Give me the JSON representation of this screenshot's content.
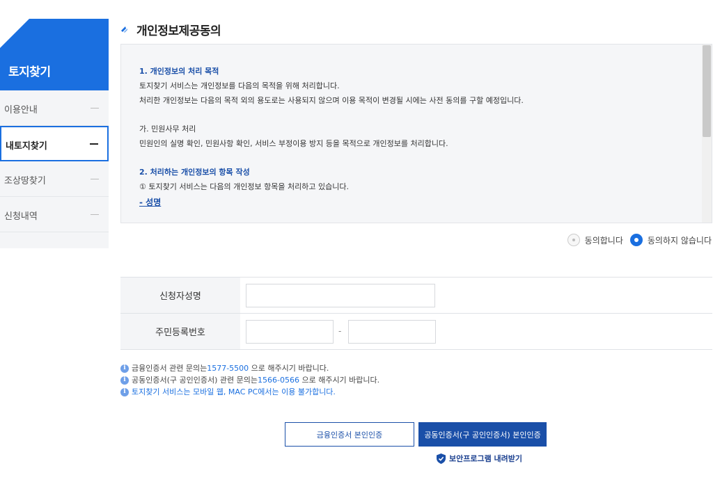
{
  "sidebar": {
    "title": "토지찾기",
    "items": [
      {
        "label": "이용안내",
        "active": false
      },
      {
        "label": "내토지찾기",
        "active": true
      },
      {
        "label": "조상땅찾기",
        "active": false
      },
      {
        "label": "신청내역",
        "active": false
      }
    ]
  },
  "section": {
    "title": "개인정보제공동의"
  },
  "terms": {
    "s1_title": "1. 개인정보의 처리 목적",
    "s1_line1": "토지찾기 서비스는 개인정보를 다음의 목적을 위해 처리합니다.",
    "s1_line2": "처리한 개인정보는 다음의 목적 외의 용도로는 사용되지 않으며 이용 목적이 변경될 시에는 사전 동의를 구할 예정입니다.",
    "ga_title": "가. 민원사무 처리",
    "ga_line1": "민원인의 실명 확인, 민원사항 확인, 서비스 부정이용 방지 등을 목적으로 개인정보를 처리합니다.",
    "s2_title": "2. 처리하는 개인정보의 항목 작성",
    "s2_line1": "① 토지찾기 서비스는 다음의 개인정보 항목을 처리하고 있습니다.",
    "s2_link": "- 성명"
  },
  "consent": {
    "agree_label": "동의합니다",
    "disagree_label": "동의하지 않습니다",
    "selected": "disagree"
  },
  "form": {
    "name_label": "신청자성명",
    "name_value": "",
    "rrn_label": "주민등록번호",
    "rrn_front": "",
    "rrn_sep": "-",
    "rrn_back": ""
  },
  "notices": {
    "n1_pre": "금융인증서 관련 문의는",
    "n1_num": "1577-5500",
    "n1_post": " 으로 해주시기 바랍니다.",
    "n2_pre": "공동인증서(구 공인인증서) 관련 문의는",
    "n2_num": "1566-0566",
    "n2_post": " 으로 해주시기 바랍니다.",
    "n3": "토지찾기 서비스는 모바일 웹, MAC PC에서는 이용 불가합니다.",
    "info_glyph": "i"
  },
  "buttons": {
    "financial_cert": "금융인증서 본인인증",
    "joint_cert": "공동인증서(구 공인인증서) 본인인증",
    "download": "보안프로그램 내려받기"
  },
  "colors": {
    "primary": "#1a6fe0",
    "navy": "#1a4fa8"
  }
}
